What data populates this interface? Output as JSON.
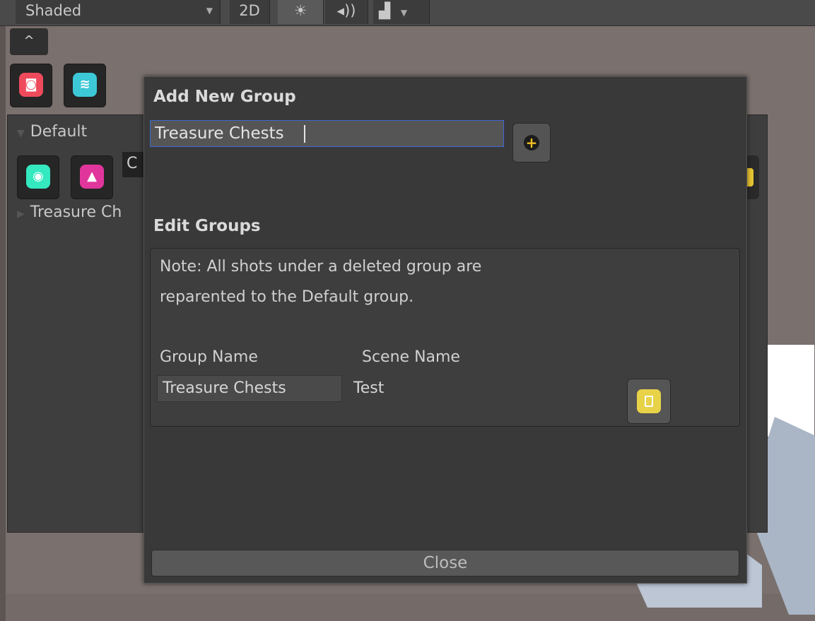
{
  "toolbar": {
    "shading_mode": "Shaded",
    "btn_2d": "2D",
    "sun_icon": "☀",
    "sound_icon": "◂))",
    "image_icon": "▟"
  },
  "panel": {
    "collapse_label": "^",
    "group_default": "Default",
    "group_treasure": "Treasure Ch",
    "field_partial": "C"
  },
  "dialog": {
    "add_title": "Add New Group",
    "group_name_value": "Treasure Chests",
    "add_button_symbol": "+",
    "edit_title": "Edit Groups",
    "note_line1": "Note: All shots under a deleted group are",
    "note_line2": "reparented to the Default group.",
    "col_group": "Group Name",
    "col_scene": "Scene Name",
    "rows": [
      {
        "group": "Treasure Chests",
        "scene": "Test"
      }
    ],
    "close_label": "Close"
  },
  "colors": {
    "accent_input_border": "#3e68d4",
    "add_icon": "#f0c020",
    "trash_icon": "#e8d248",
    "camera_icon": "#ef4a5c",
    "layers_icon": "#3cc8d6",
    "eye_icon": "#34e8c0",
    "pin_icon": "#e0369c"
  }
}
